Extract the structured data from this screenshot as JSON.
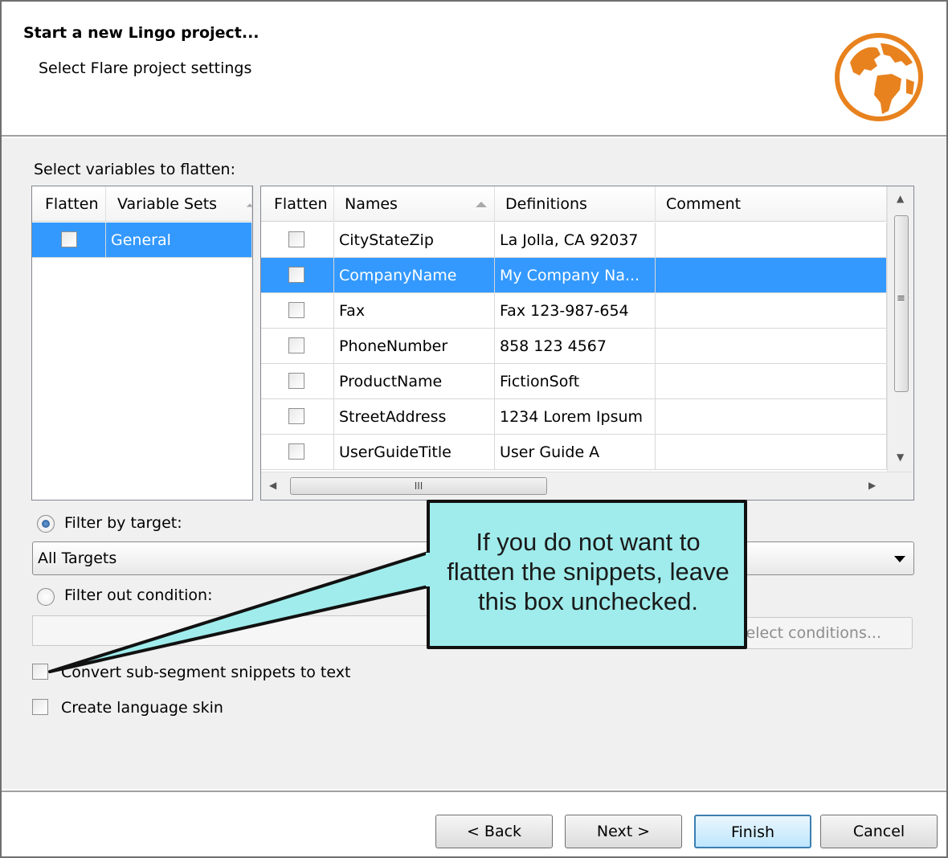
{
  "header": {
    "title": "Start a new Lingo project...",
    "subtitle": "Select Flare project settings"
  },
  "variables_label": "Select variables to flatten:",
  "sets_table": {
    "columns": [
      "Flatten",
      "Variable Sets"
    ],
    "rows": [
      {
        "name": "General",
        "checked": false,
        "selected": true
      }
    ]
  },
  "vars_table": {
    "columns": [
      "Flatten",
      "Names",
      "Definitions",
      "Comment"
    ],
    "rows": [
      {
        "name": "CityStateZip",
        "definition": "La Jolla, CA 92037",
        "comment": "",
        "checked": false
      },
      {
        "name": "CompanyName",
        "definition": "My Company Na...",
        "comment": "",
        "checked": false
      },
      {
        "name": "Fax",
        "definition": "Fax 123-987-654",
        "comment": "",
        "checked": false
      },
      {
        "name": "PhoneNumber",
        "definition": "858 123 4567",
        "comment": "",
        "checked": false
      },
      {
        "name": "ProductName",
        "definition": "FictionSoft",
        "comment": "",
        "checked": false
      },
      {
        "name": "StreetAddress",
        "definition": "1234 Lorem Ipsum",
        "comment": "",
        "checked": false
      },
      {
        "name": "UserGuideTitle",
        "definition": "User Guide A",
        "comment": "",
        "checked": false
      }
    ],
    "selected_row": 1,
    "hscroll_grip": "III"
  },
  "filter": {
    "by_target_label": "Filter by target:",
    "by_target_selected": true,
    "target_value": "All Targets",
    "out_condition_label": "Filter out condition:",
    "out_condition_selected": false,
    "select_conditions_label": "elect conditions..."
  },
  "options": {
    "convert_snippets_label": "Convert sub-segment snippets to text",
    "convert_snippets_checked": false,
    "language_skin_label": "Create language skin",
    "language_skin_checked": false
  },
  "callout": {
    "line1": "If you do not want to",
    "line2": "flatten the snippets, leave",
    "line3": "this box unchecked.",
    "fill_color": "#a0ecec"
  },
  "buttons": {
    "back": "< Back",
    "next": "Next >",
    "finish": "Finish",
    "cancel": "Cancel"
  },
  "icons": {
    "logo": "globe-icon",
    "accent": "#e8821e"
  }
}
